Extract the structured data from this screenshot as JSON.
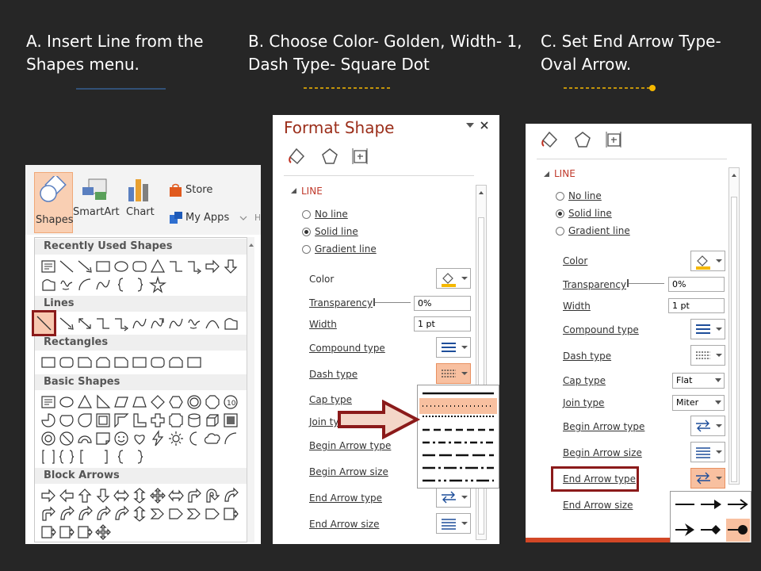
{
  "steps": {
    "a": {
      "line1": "A. Insert Line from the",
      "line2": "Shapes menu."
    },
    "b": {
      "line1": "B. Choose Color- Golden, Width- 1,",
      "line2": "Dash Type- Square Dot"
    },
    "c": {
      "line1": "C. Set End Arrow Type-",
      "line2": "Oval Arrow."
    }
  },
  "shapes_panel": {
    "ribbon": {
      "shapes": "Shapes",
      "smartart": "SmartArt",
      "chart": "Chart",
      "store": "Store",
      "my_apps": "My Apps"
    },
    "sections": {
      "recent": "Recently Used Shapes",
      "lines": "Lines",
      "rectangles": "Rectangles",
      "basic": "Basic Shapes",
      "block": "Block Arrows"
    }
  },
  "format_shape": {
    "title": "Format Shape",
    "section": "LINE",
    "radios": {
      "no_line": "No line",
      "solid": "Solid line",
      "gradient": "Gradient line"
    },
    "labels": {
      "color": "Color",
      "transparency": "Transparency",
      "width": "Width",
      "compound": "Compound type",
      "dash": "Dash type",
      "cap": "Cap type",
      "join": "Join type",
      "begin_type": "Begin Arrow type",
      "begin_size": "Begin Arrow size",
      "end_type": "End Arrow type",
      "end_size": "End Arrow size"
    },
    "values": {
      "transparency": "0%",
      "width": "1 pt",
      "cap": "Flat",
      "join": "Miter"
    }
  },
  "colors": {
    "background": "#262626",
    "highlight": "#8b1a1a",
    "accent_gold": "#f5b800",
    "active_orange": "#f8c0a0",
    "blue_rule": "#3f7cc8"
  }
}
